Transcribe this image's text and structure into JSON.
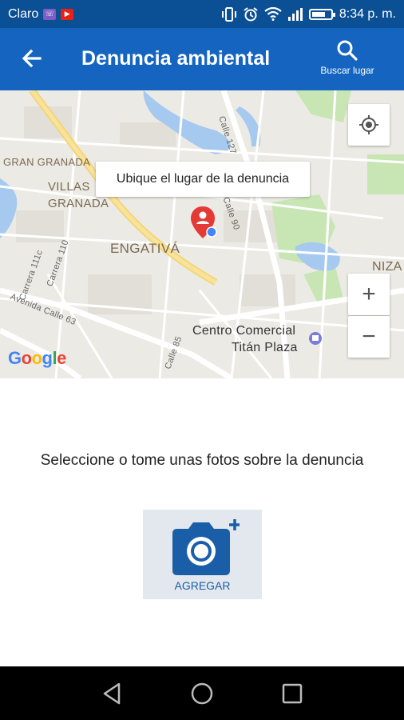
{
  "status_bar": {
    "carrier": "Claro",
    "time": "8:34 p. m.",
    "icons": [
      "viber-icon",
      "youtube-icon",
      "vibrate-icon",
      "alarm-icon",
      "wifi-icon",
      "signal-icon",
      "battery-icon"
    ]
  },
  "app_bar": {
    "title": "Denuncia ambiental",
    "search_label": "Buscar lugar",
    "color": "#1565c0"
  },
  "map": {
    "tooltip": "Ubique el lugar de la denuncia",
    "labels": {
      "gran_granada": "GRAN GRANADA",
      "villas_1": "VILLAS",
      "villas_2": "GRANADA",
      "engativa": "ENGATIVÁ",
      "niza": "NIZA",
      "poi_1": "Centro Comercial",
      "poi_2": "Titán Plaza"
    },
    "streets": {
      "calle_127": "Calle 127",
      "calle_90": "Calle 90",
      "carrera_111c": "Carrera 111c",
      "carrera_110": "Carrera 110",
      "avenida_calle_63": "Avenida Calle 63",
      "calle_85": "Calle 85"
    },
    "zoom_in": "+",
    "zoom_out": "−",
    "google": {
      "letters": [
        "G",
        "o",
        "o",
        "g",
        "l",
        "e"
      ],
      "colors": [
        "#4285f4",
        "#ea4335",
        "#fbbc05",
        "#4285f4",
        "#34a853",
        "#ea4335"
      ]
    },
    "marker_color": "#e53935"
  },
  "content": {
    "prompt": "Seleccione o tome unas fotos sobre la denuncia",
    "add_label": "AGREGAR",
    "accent": "#1a5ea8"
  }
}
